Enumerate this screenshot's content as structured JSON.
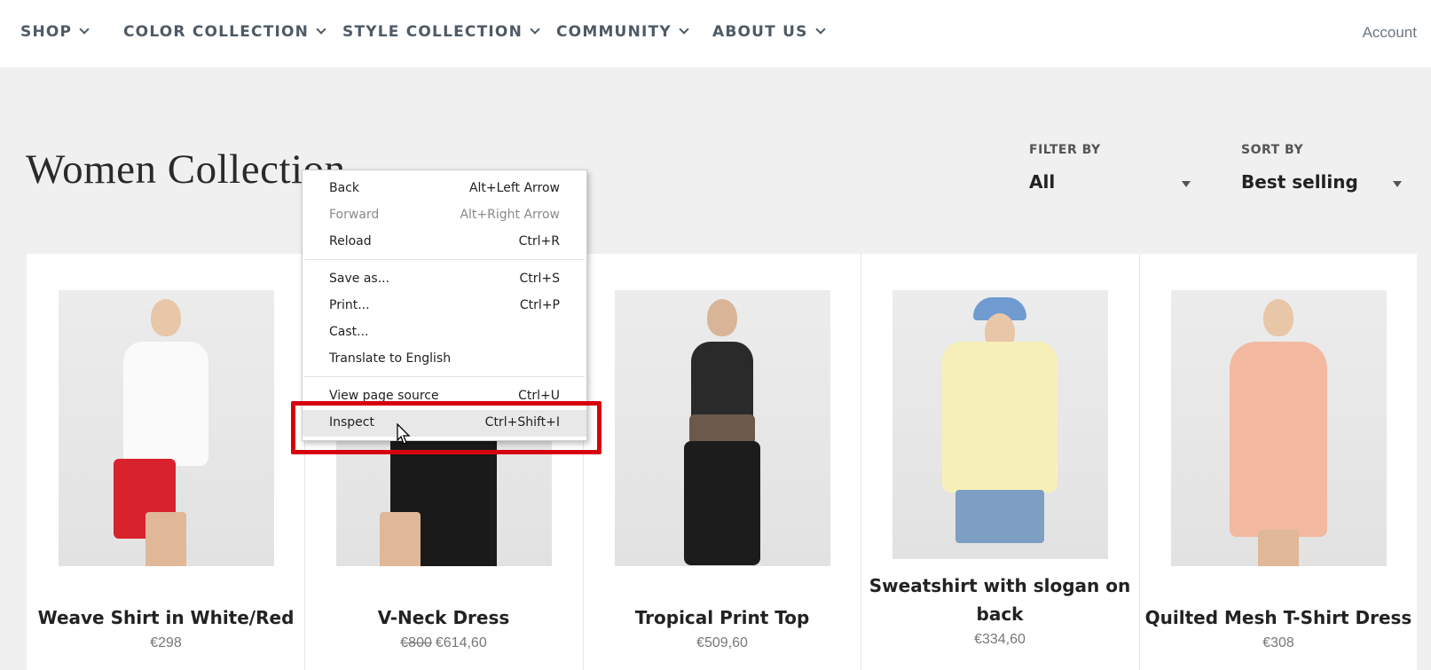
{
  "nav": {
    "items": [
      "SHOP",
      "COLOR COLLECTION",
      "STYLE COLLECTION",
      "COMMUNITY",
      "ABOUT US"
    ],
    "account": "Account"
  },
  "page": {
    "title": "Women Collection",
    "filter": {
      "label": "FILTER BY",
      "value": "All"
    },
    "sort": {
      "label": "SORT BY",
      "value": "Best selling"
    }
  },
  "products": [
    {
      "title": "Weave Shirt in White/Red",
      "price": "€298",
      "old_price": ""
    },
    {
      "title": "V-Neck Dress",
      "price": "€614,60",
      "old_price": "€800"
    },
    {
      "title": "Tropical Print Top",
      "price": "€509,60",
      "old_price": ""
    },
    {
      "title": "Sweatshirt with slogan on back",
      "price": "€334,60",
      "old_price": ""
    },
    {
      "title": "Quilted Mesh T-Shirt Dress",
      "price": "€308",
      "old_price": ""
    }
  ],
  "context_menu": {
    "items": [
      {
        "label": "Back",
        "shortcut": "Alt+Left Arrow"
      },
      {
        "label": "Forward",
        "shortcut": "Alt+Right Arrow"
      },
      {
        "label": "Reload",
        "shortcut": "Ctrl+R"
      },
      {
        "label": "Save as...",
        "shortcut": "Ctrl+S"
      },
      {
        "label": "Print...",
        "shortcut": "Ctrl+P"
      },
      {
        "label": "Cast...",
        "shortcut": ""
      },
      {
        "label": "Translate to English",
        "shortcut": ""
      },
      {
        "label": "View page source",
        "shortcut": "Ctrl+U"
      },
      {
        "label": "Inspect",
        "shortcut": "Ctrl+Shift+I"
      }
    ]
  },
  "colors": {
    "highlight": "#d6000f",
    "nav_text": "#4e5a66"
  }
}
